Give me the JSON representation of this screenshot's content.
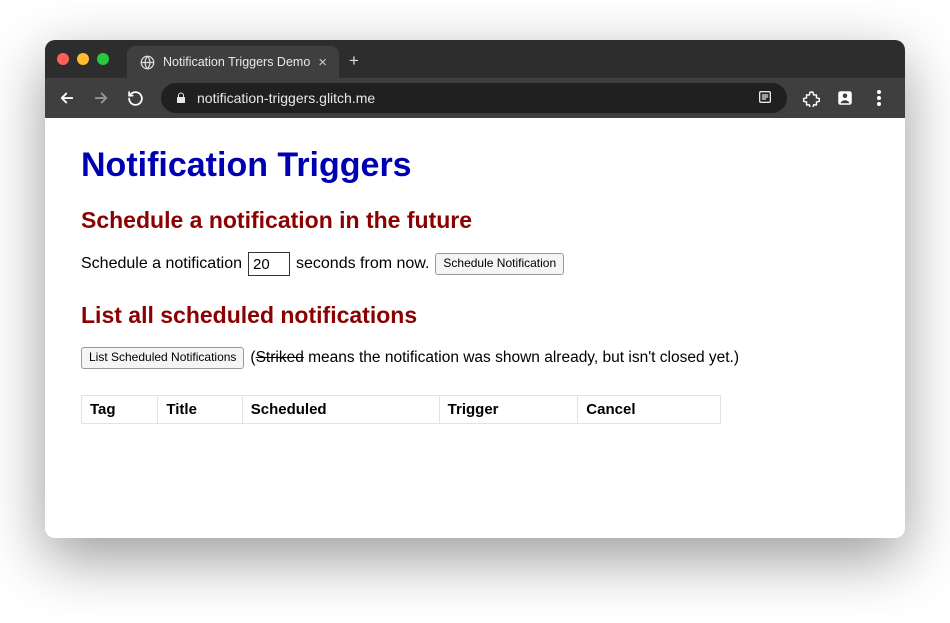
{
  "browser": {
    "tab_title": "Notification Triggers Demo",
    "url": "notification-triggers.glitch.me"
  },
  "page": {
    "h1": "Notification Triggers",
    "section_schedule": {
      "heading": "Schedule a notification in the future",
      "text_before": "Schedule a notification",
      "seconds_value": "20",
      "text_after": "seconds from now.",
      "button": "Schedule Notification"
    },
    "section_list": {
      "heading": "List all scheduled notifications",
      "button": "List Scheduled Notifications",
      "note_open": "(",
      "note_striked": "Striked",
      "note_rest": " means the notification was shown already, but isn't closed yet.)",
      "columns": [
        "Tag",
        "Title",
        "Scheduled",
        "Trigger",
        "Cancel"
      ]
    }
  }
}
